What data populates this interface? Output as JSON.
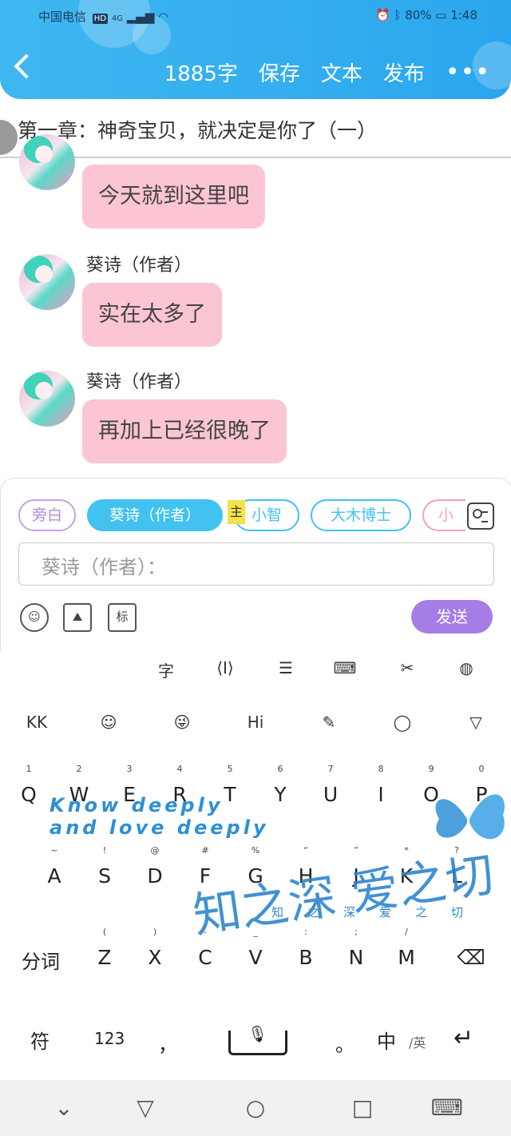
{
  "status_bar": {
    "carrier": "中国电信",
    "hd": "HD",
    "network": "4G",
    "battery_text": "80%",
    "time": "1:48"
  },
  "header": {
    "word_count": "1885字",
    "save": "保存",
    "text": "文本",
    "publish": "发布",
    "more": "•••",
    "bg_color": "#2aa6ee"
  },
  "chapter": {
    "title": "第一章：神奇宝贝，就决定是你了（一）"
  },
  "messages": [
    {
      "author": "",
      "text": "今天就到这里吧"
    },
    {
      "author": "葵诗（作者）",
      "text": "实在太多了"
    },
    {
      "author": "葵诗（作者）",
      "text": "再加上已经很晚了"
    }
  ],
  "composer": {
    "roles": [
      {
        "label": "旁白",
        "color": "#c9a0e8",
        "selected": false
      },
      {
        "label": "葵诗（作者）",
        "color": "#42c2ef",
        "selected": true
      },
      {
        "label": "小智",
        "color": "#42c2ef",
        "selected": false
      },
      {
        "label": "大木博士",
        "color": "#42c2ef",
        "selected": false
      },
      {
        "label": "小",
        "color": "#f3a0c6",
        "selected": false
      }
    ],
    "main_tag": "主",
    "input_placeholder": "葵诗（作者）：",
    "tag_button": "标",
    "send": "发送",
    "send_color": "#a67de6"
  },
  "keyboard": {
    "toolbar": [
      "字",
      "⟨I⟩",
      "☰",
      "⌨",
      "✂",
      "◍"
    ],
    "icon_row": [
      "KK",
      "☺",
      "😜",
      "Hi",
      "✎",
      "◯",
      "▽"
    ],
    "row1": [
      {
        "k": "Q",
        "h": "1"
      },
      {
        "k": "W",
        "h": "2"
      },
      {
        "k": "E",
        "h": "3"
      },
      {
        "k": "R",
        "h": "4"
      },
      {
        "k": "T",
        "h": "5"
      },
      {
        "k": "Y",
        "h": "6"
      },
      {
        "k": "U",
        "h": "7"
      },
      {
        "k": "I",
        "h": "8"
      },
      {
        "k": "O",
        "h": "9"
      },
      {
        "k": "P",
        "h": "0"
      }
    ],
    "row2": [
      {
        "k": "A",
        "h": "~"
      },
      {
        "k": "S",
        "h": "!"
      },
      {
        "k": "D",
        "h": "@"
      },
      {
        "k": "F",
        "h": "#"
      },
      {
        "k": "G",
        "h": "%"
      },
      {
        "k": "H",
        "h": "“"
      },
      {
        "k": "J",
        "h": "”"
      },
      {
        "k": "K",
        "h": "*"
      },
      {
        "k": "L",
        "h": "?"
      }
    ],
    "row3": [
      {
        "k": "Z",
        "h": "("
      },
      {
        "k": "X",
        "h": ")"
      },
      {
        "k": "C",
        "h": "-"
      },
      {
        "k": "V",
        "h": "_"
      },
      {
        "k": "B",
        "h": ":"
      },
      {
        "k": "N",
        "h": ";"
      },
      {
        "k": "M",
        "h": "/"
      }
    ],
    "fenci": "分词",
    "fu": "符",
    "num": "123",
    "comma": "，",
    "period": "。",
    "zh": "中",
    "en": "/英",
    "brand_line1": "Know deeply",
    "brand_line2": "and love deeply",
    "brand_cn": "知之深 爱之切",
    "brand_cn_small": "知之深爱之切"
  }
}
